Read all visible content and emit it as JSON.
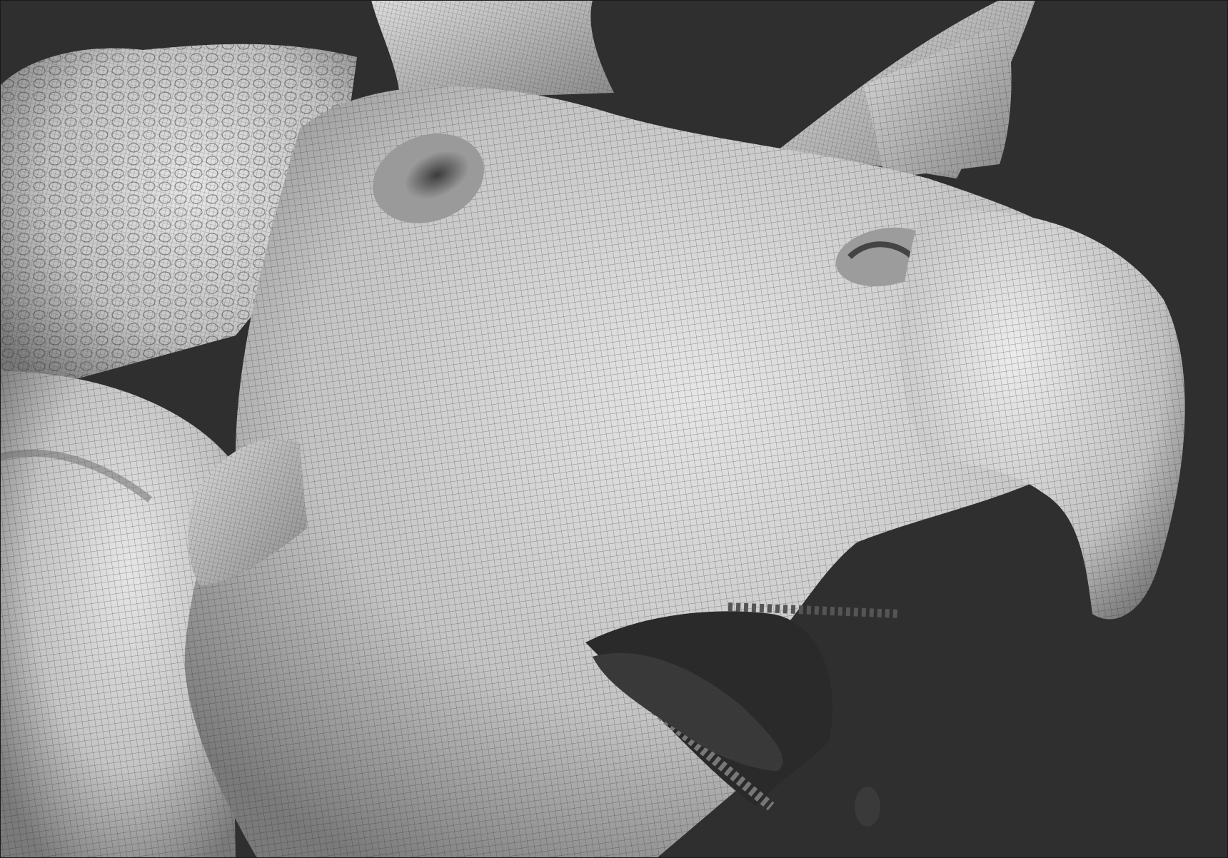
{
  "viewport": {
    "background_color": "#2f2f2f"
  },
  "model": {
    "subject": "sculpted-ceratopsian-dinosaur-head",
    "display_mode": "wireframe-on-clay",
    "clay_color": "#c9c9c9",
    "clay_highlight": "#e6e6e6",
    "clay_shadow": "#6a6a6a",
    "wire_color": "#1e1e1e",
    "tongue_color": "#3a3a3a"
  }
}
